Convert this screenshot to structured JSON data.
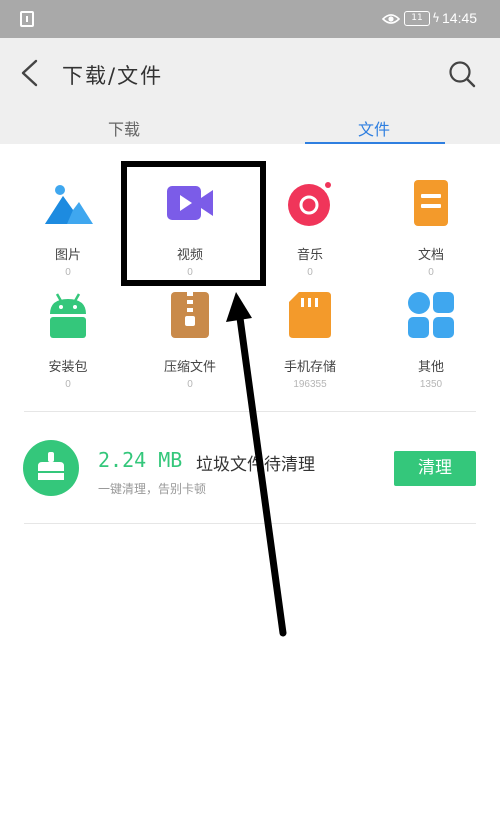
{
  "status_bar": {
    "time": "14:45",
    "battery": "11"
  },
  "header": {
    "title": "下载/文件"
  },
  "tabs": [
    {
      "label": "下载",
      "active": false
    },
    {
      "label": "文件",
      "active": true
    }
  ],
  "categories": [
    {
      "label": "图片",
      "count": "0",
      "icon": "image-icon"
    },
    {
      "label": "视频",
      "count": "0",
      "icon": "video-icon"
    },
    {
      "label": "音乐",
      "count": "0",
      "icon": "music-icon"
    },
    {
      "label": "文档",
      "count": "0",
      "icon": "document-icon"
    },
    {
      "label": "安装包",
      "count": "0",
      "icon": "android-icon"
    },
    {
      "label": "压缩文件",
      "count": "0",
      "icon": "zip-icon"
    },
    {
      "label": "手机存储",
      "count": "196355",
      "icon": "sd-card-icon"
    },
    {
      "label": "其他",
      "count": "1350",
      "icon": "other-icon"
    }
  ],
  "cleanup": {
    "size": "2.24 MB",
    "title": "垃圾文件待清理",
    "subtitle": "一键清理，告别卡顿",
    "button_label": "清理"
  },
  "colors": {
    "accent_blue": "#2f7fe0",
    "green": "#34c77b",
    "video_purple": "#7b5ce8",
    "music_pink": "#f0355a",
    "doc_orange": "#f39a2b",
    "other_blue": "#3fa7ef"
  }
}
